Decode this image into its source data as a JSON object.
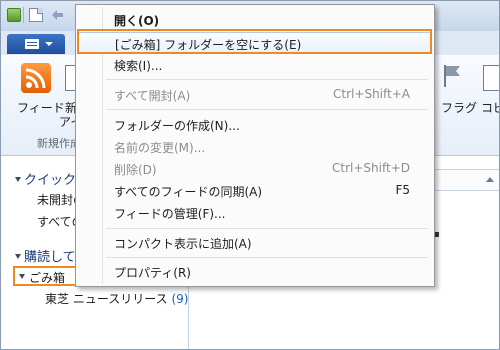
{
  "ribbon": {
    "feed_label": "フィード",
    "new_label_partial": "新",
    "new_label_partial2": "アイ",
    "group_label_partial": "新規作成",
    "flag_label": "フラグ",
    "copy_label_partial": "コピ"
  },
  "sidebar": {
    "quick_header": "クイック分",
    "quick_items": [
      "未開封の",
      "すべての"
    ],
    "subscribed_header": "購読して",
    "trash_label": "ごみ箱",
    "feed_item": {
      "label": "東芝  ニュースリリース",
      "count": "(9)"
    }
  },
  "context_menu": {
    "items": [
      {
        "label": "開く(O)",
        "shortcut": "",
        "bold": true,
        "disabled": false
      },
      {
        "label": "[ごみ箱] フォルダーを空にする(E)",
        "shortcut": "",
        "bold": false,
        "disabled": false
      },
      {
        "label": "検索(I)...",
        "shortcut": "",
        "bold": false,
        "disabled": false
      },
      {
        "label": "すべて開封(A)",
        "shortcut": "Ctrl+Shift+A",
        "bold": false,
        "disabled": true
      },
      {
        "label": "フォルダーの作成(N)...",
        "shortcut": "",
        "bold": false,
        "disabled": false
      },
      {
        "label": "名前の変更(M)...",
        "shortcut": "",
        "bold": false,
        "disabled": true
      },
      {
        "label": "削除(D)",
        "shortcut": "Ctrl+Shift+D",
        "bold": false,
        "disabled": true
      },
      {
        "label": "すべてのフィードの同期(A)",
        "shortcut": "F5",
        "bold": false,
        "disabled": false
      },
      {
        "label": "フィードの管理(F)...",
        "shortcut": "",
        "bold": false,
        "disabled": false
      },
      {
        "label": "コンパクト表示に追加(A)",
        "shortcut": "",
        "bold": false,
        "disabled": false
      },
      {
        "label": "プロパティ(R)",
        "shortcut": "",
        "bold": false,
        "disabled": false
      }
    ]
  },
  "icons": {
    "app": "app-icon",
    "new_doc": "new-document-icon",
    "undo": "undo-arrow-icon",
    "menu_button": "ribbon-menu-icon",
    "rss": "rss-feed-icon",
    "flag": "flag-icon",
    "copy": "copy-icon"
  },
  "colors": {
    "callout_outline": "#f08a1e",
    "menu_highlight": "#e8f1fb",
    "rss_orange": "#e35f00",
    "ribbon_blue": "#1d4f9e"
  }
}
